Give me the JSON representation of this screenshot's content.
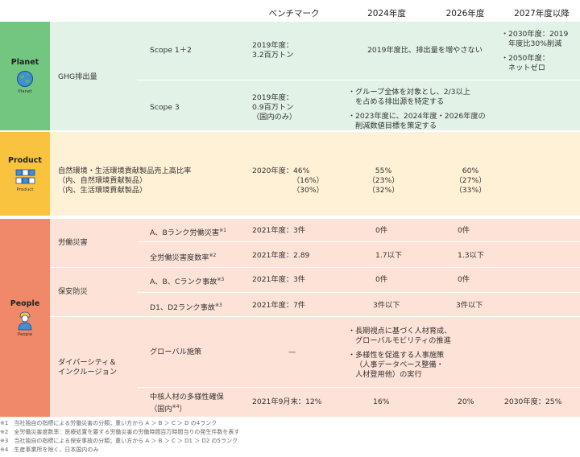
{
  "headers": {
    "benchmark": "ベンチマーク",
    "y2024": "2024年度",
    "y2026": "2026年度",
    "y2027": "2027年度以降"
  },
  "planet": {
    "title": "Planet",
    "icon_label": "Planet",
    "ghg": "GHG排出量",
    "scope1": {
      "label": "Scope 1＋2",
      "bench1": "2019年度：",
      "bench2": "3.2百万トン",
      "target": "2019年度比、排出量を増やさない",
      "b1l1": "2030年度：2019",
      "b1l2": "年度比30%削減",
      "b2l1": "2050年度：",
      "b2l2": "ネットゼロ"
    },
    "scope3": {
      "label": "Scope 3",
      "bench1": "2019年度：",
      "bench2": "0.9百万トン",
      "bench3": "（国内のみ）",
      "b1l1": "グループ全体を対象とし、2/3以上",
      "b1l2": "を占める排出源を特定する",
      "b2l1": "2023年度に、2024年度・2026年度の",
      "b2l2": "削減数値目標を策定する"
    }
  },
  "product": {
    "title": "Product",
    "icon_label": "Product",
    "l1": "自然環境・生活環境貢献製品売上高比率",
    "l2": "（内、自然環境貢献製品）",
    "l3": "（内、生活環境貢献製品）",
    "bench1": "2020年度：46%",
    "bench2": "（16%）",
    "bench3": "（30%）",
    "v24_1": "55%",
    "v24_2": "（23%）",
    "v24_3": "（32%）",
    "v26_1": "60%",
    "v26_2": "（27%）",
    "v26_3": "（33%）"
  },
  "people": {
    "title": "People",
    "icon_label": "People",
    "labor": {
      "label": "労働災害",
      "r1": {
        "label": "A、Bランク労働災害",
        "sup": "※1",
        "bench": "2021年度：3件",
        "v24": "0件",
        "v26": "0件"
      },
      "r2": {
        "label": "全労働災害度数率",
        "sup": "※2",
        "bench": "2021年度：2.89",
        "v24": "1.7以下",
        "v26": "1.3以下"
      }
    },
    "safety": {
      "label": "保安防災",
      "r1": {
        "label": "A、B、Cランク事故",
        "sup": "※3",
        "bench": "2021年度：3件",
        "v24": "0件",
        "v26": "0件"
      },
      "r2": {
        "label": "D1、D2ランク事故",
        "sup": "※3",
        "bench": "2021年度：7件",
        "v24": "3件以下",
        "v26": "3件以下"
      }
    },
    "diversity": {
      "label1": "ダイバーシティ＆",
      "label2": "インクルージョン",
      "global": {
        "label": "グローバル施策",
        "bench": "—",
        "b1l1": "長期視点に基づく人材育成、",
        "b1l2": "グローバルモビリティの推進",
        "b2l1": "多様性を促進する人事施策",
        "b2l2": "（人事データベース整備・",
        "b2l3": "人材登用他）の実行"
      },
      "core": {
        "label1": "中核人材の多様性確保",
        "label2": "（国内",
        "sup": "※4",
        "label3": "）",
        "bench": "2021年9月末：12%",
        "v24": "16%",
        "v26": "20%",
        "v27": "2030年度：25%"
      }
    }
  },
  "notes": [
    "※1　当社独自の指標による労働災害の分類；重い方から A ＞ B ＞ C ＞ D の4ランク",
    "※2　全労働災害度数率：医療処置を要する労働災害の労働時間百万時間当りの発生件数を表す",
    "※3　当社独自の指標による保安事故の分類；重い方から A ＞ B ＞ C ＞ D1 ＞ D2 の5ランク",
    "※4　生産事業所を除く、日本国内のみ"
  ],
  "colors": {
    "planet_dark": "#72c680",
    "planet_light": "#e2f2e6",
    "product_dark": "#f9c33f",
    "product_light": "#fff1d6",
    "people_dark": "#f0896a",
    "people_light": "#fde2d7"
  }
}
